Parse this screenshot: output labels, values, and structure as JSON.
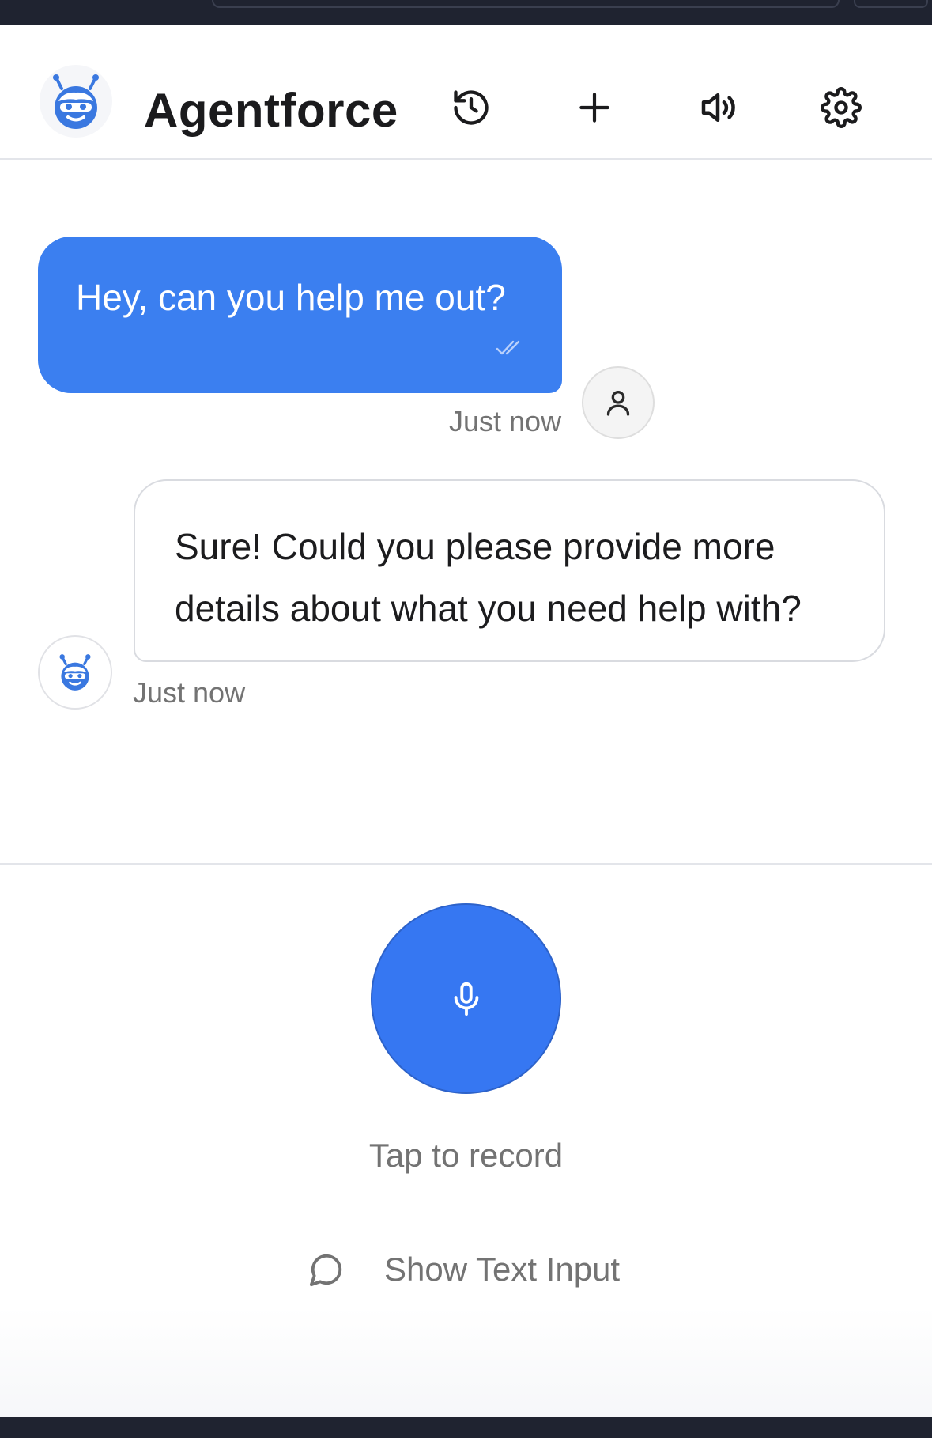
{
  "header": {
    "title": "Agentforce",
    "actions": [
      {
        "name": "history",
        "icon": "history-icon"
      },
      {
        "name": "new-chat",
        "icon": "plus-icon"
      },
      {
        "name": "audio",
        "icon": "speaker-icon"
      },
      {
        "name": "settings",
        "icon": "gear-icon"
      }
    ]
  },
  "messages": [
    {
      "sender": "user",
      "text": "Hey, can you help me out?",
      "time": "Just now",
      "status_icon": "double-check-icon"
    },
    {
      "sender": "agent",
      "text": "Sure! Could you please provide more details about what you need help with?",
      "time": "Just now"
    }
  ],
  "controls": {
    "mic_icon": "microphone-icon",
    "record_label": "Tap to record",
    "text_input_label": "Show Text Input",
    "text_input_icon": "chat-bubble-icon"
  },
  "colors": {
    "accent": "#3677f2",
    "user_bubble": "#3b7ff0",
    "text_primary": "#1c1c1e",
    "text_secondary": "#737373",
    "system_bar": "#1f2330"
  }
}
